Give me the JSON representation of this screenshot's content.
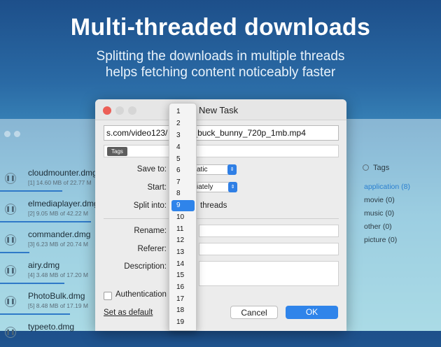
{
  "hero": {
    "title": "Multi-threaded downloads",
    "subtitle_line1": "Splitting the downloads in multiple threads",
    "subtitle_line2": "helps fetching content noticeably faster"
  },
  "downloads": [
    {
      "name": "cloudmounter.dmg",
      "info": "[1] 14.60 MB of 22.77 M",
      "progress": 0.64
    },
    {
      "name": "elmediaplayer.dmg",
      "info": "[2] 9.05 MB of 42.22 M",
      "progress": 0.21
    },
    {
      "name": "commander.dmg",
      "info": "[3] 6.23 MB of 20.74 M",
      "progress": 0.3
    },
    {
      "name": "airy.dmg",
      "info": "[4] 3.48 MB of 17.20 M",
      "progress": 0.2
    },
    {
      "name": "PhotoBulk.dmg",
      "info": "[5] 8.48 MB of 17.19 M",
      "progress": 0.49
    },
    {
      "name": "typeeto.dmg",
      "info": "",
      "progress": 0
    }
  ],
  "tags_panel": {
    "header": "Tags",
    "items": [
      {
        "label": "application (8)",
        "selected": true
      },
      {
        "label": "movie (0)",
        "selected": false
      },
      {
        "label": "music (0)",
        "selected": false
      },
      {
        "label": "other (0)",
        "selected": false
      },
      {
        "label": "picture (0)",
        "selected": false
      }
    ]
  },
  "dialog": {
    "title": "New Task",
    "url": "s.com/video123/                   20/big_buck_bunny_720p_1mb.mp4",
    "tags_chip": "Tags",
    "save_to_label": "Save to:",
    "save_to_value": "atic",
    "start_label": "Start:",
    "start_value": "iately",
    "split_label": "Split into:",
    "threads_label": "threads",
    "rename_label": "Rename:",
    "referer_label": "Referer:",
    "description_label": "Description:",
    "auth_label": "Authentication",
    "set_default": "Set as default",
    "cancel": "Cancel",
    "ok": "OK"
  },
  "thread_menu": {
    "options": [
      "1",
      "2",
      "3",
      "4",
      "5",
      "6",
      "7",
      "8",
      "9",
      "10",
      "11",
      "12",
      "13",
      "14",
      "15",
      "16",
      "17",
      "18",
      "19"
    ],
    "selected": "9"
  },
  "colors": {
    "accent": "#2f84ea",
    "close": "#ec5f57"
  }
}
